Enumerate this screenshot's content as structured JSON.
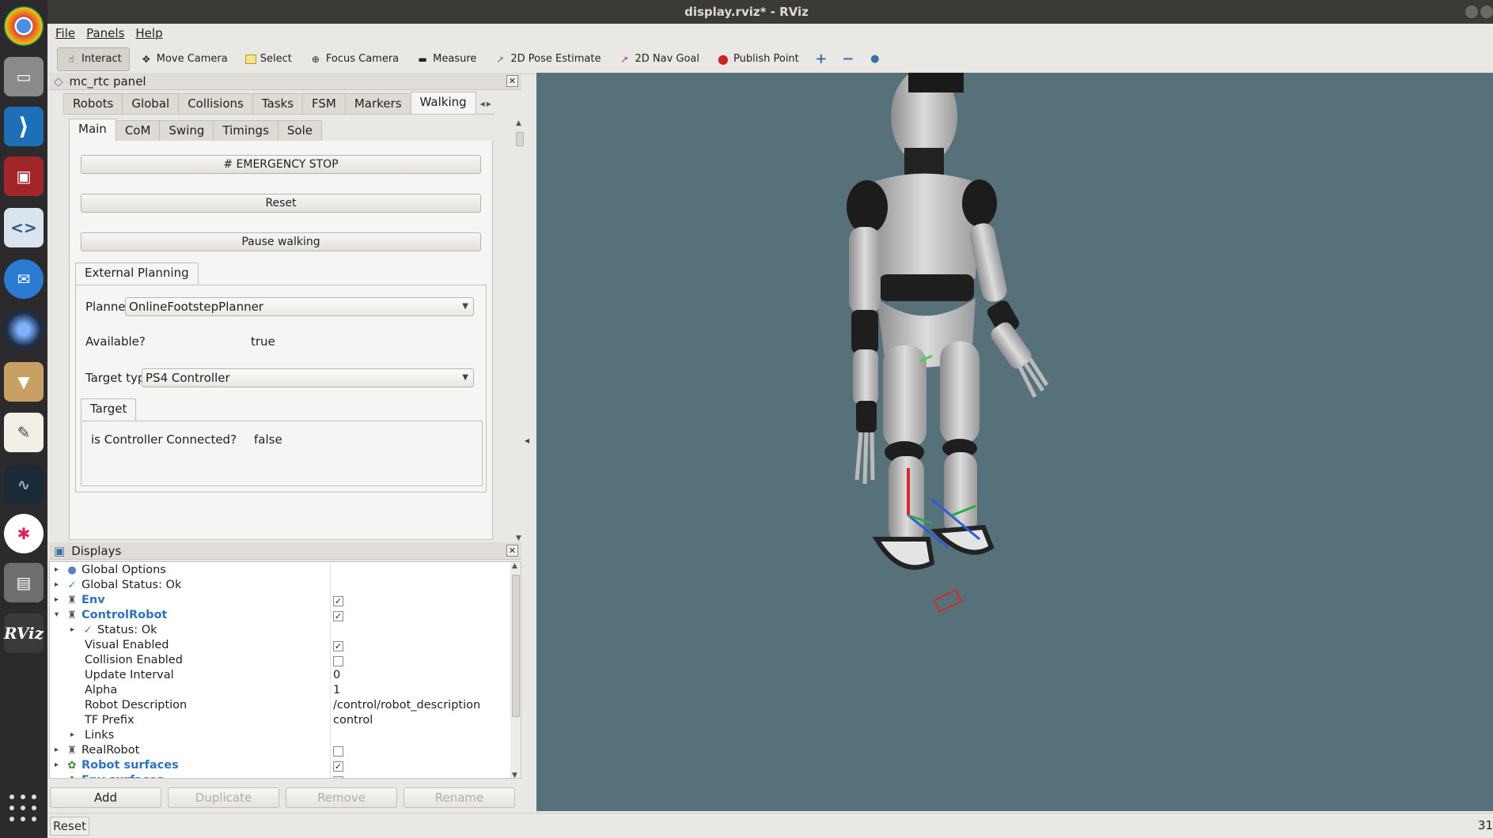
{
  "window": {
    "title": "display.rviz* - RViz"
  },
  "menu": [
    "File",
    "Panels",
    "Help"
  ],
  "toolbar": {
    "tools": [
      {
        "label": "Interact",
        "icon": "hand-icon",
        "active": true
      },
      {
        "label": "Move Camera",
        "icon": "move-icon",
        "active": false
      },
      {
        "label": "Select",
        "icon": "select-box-icon",
        "active": false
      },
      {
        "label": "Focus Camera",
        "icon": "focus-icon",
        "active": false
      },
      {
        "label": "Measure",
        "icon": "ruler-icon",
        "active": false
      },
      {
        "label": "2D Pose Estimate",
        "icon": "green-arrow-icon",
        "active": false
      },
      {
        "label": "2D Nav Goal",
        "icon": "pink-arrow-icon",
        "active": false
      },
      {
        "label": "Publish Point",
        "icon": "pin-icon",
        "active": false
      }
    ]
  },
  "mc_panel": {
    "title": "mc_rtc panel",
    "top_tabs": [
      "Robots",
      "Global",
      "Collisions",
      "Tasks",
      "FSM",
      "Markers",
      "Walking"
    ],
    "top_selected": "Walking",
    "sub_tabs": [
      "Main",
      "CoM",
      "Swing",
      "Timings",
      "Sole"
    ],
    "sub_selected": "Main",
    "buttons": {
      "emergency": "# EMERGENCY STOP",
      "reset": "Reset",
      "pause": "Pause walking"
    },
    "external_planning": {
      "tab": "External Planning",
      "planner_label": "Planner",
      "planner_value": "OnlineFootstepPlanner",
      "available_label": "Available?",
      "available_value": "true",
      "target_type_label": "Target type",
      "target_type_value": "PS4 Controller",
      "target_tab": "Target",
      "controller_label": "is Controller Connected?",
      "controller_value": "false"
    }
  },
  "displays": {
    "title": "Displays",
    "rows": [
      {
        "label": "Global Options",
        "indent": 0,
        "expand": "right",
        "icon": "globe-icon",
        "link": false
      },
      {
        "label": "Global Status: Ok",
        "indent": 0,
        "expand": "right",
        "icon": "check-icon",
        "link": false
      },
      {
        "label": "Env",
        "indent": 0,
        "expand": "right",
        "icon": "robot-icon",
        "link": true,
        "check": true
      },
      {
        "label": "ControlRobot",
        "indent": 0,
        "expand": "down",
        "icon": "robot-icon",
        "link": true,
        "check": true
      },
      {
        "label": "Status: Ok",
        "indent": 1,
        "expand": "right",
        "icon": "check-icon",
        "link": false
      },
      {
        "label": "Visual Enabled",
        "indent": 1,
        "expand": "",
        "icon": "",
        "link": false,
        "check": true
      },
      {
        "label": "Collision Enabled",
        "indent": 1,
        "expand": "",
        "icon": "",
        "link": false,
        "check": false
      },
      {
        "label": "Update Interval",
        "indent": 1,
        "expand": "",
        "icon": "",
        "link": false,
        "value": "0"
      },
      {
        "label": "Alpha",
        "indent": 1,
        "expand": "",
        "icon": "",
        "link": false,
        "value": "1"
      },
      {
        "label": "Robot Description",
        "indent": 1,
        "expand": "",
        "icon": "",
        "link": false,
        "value": "/control/robot_description"
      },
      {
        "label": "TF Prefix",
        "indent": 1,
        "expand": "",
        "icon": "",
        "link": false,
        "value": "control"
      },
      {
        "label": "Links",
        "indent": 1,
        "expand": "right",
        "icon": "",
        "link": false
      },
      {
        "label": "RealRobot",
        "indent": 0,
        "expand": "right",
        "icon": "robot-icon",
        "link": false,
        "check": false
      },
      {
        "label": "Robot surfaces",
        "indent": 0,
        "expand": "right",
        "icon": "surfaces-icon",
        "link": true,
        "check": true
      },
      {
        "label": "Env surfaces",
        "indent": 0,
        "expand": "right",
        "icon": "surfaces-icon",
        "link": true,
        "check": true
      }
    ],
    "buttons": [
      "Add",
      "Duplicate",
      "Remove",
      "Rename"
    ],
    "buttons_disabled": [
      false,
      true,
      true,
      true
    ]
  },
  "status": {
    "reset": "Reset",
    "fps": "31"
  },
  "colors": {
    "viewport_bg": "#57717a",
    "link_blue": "#2f73c0",
    "title_bar": "#3b3a37"
  }
}
